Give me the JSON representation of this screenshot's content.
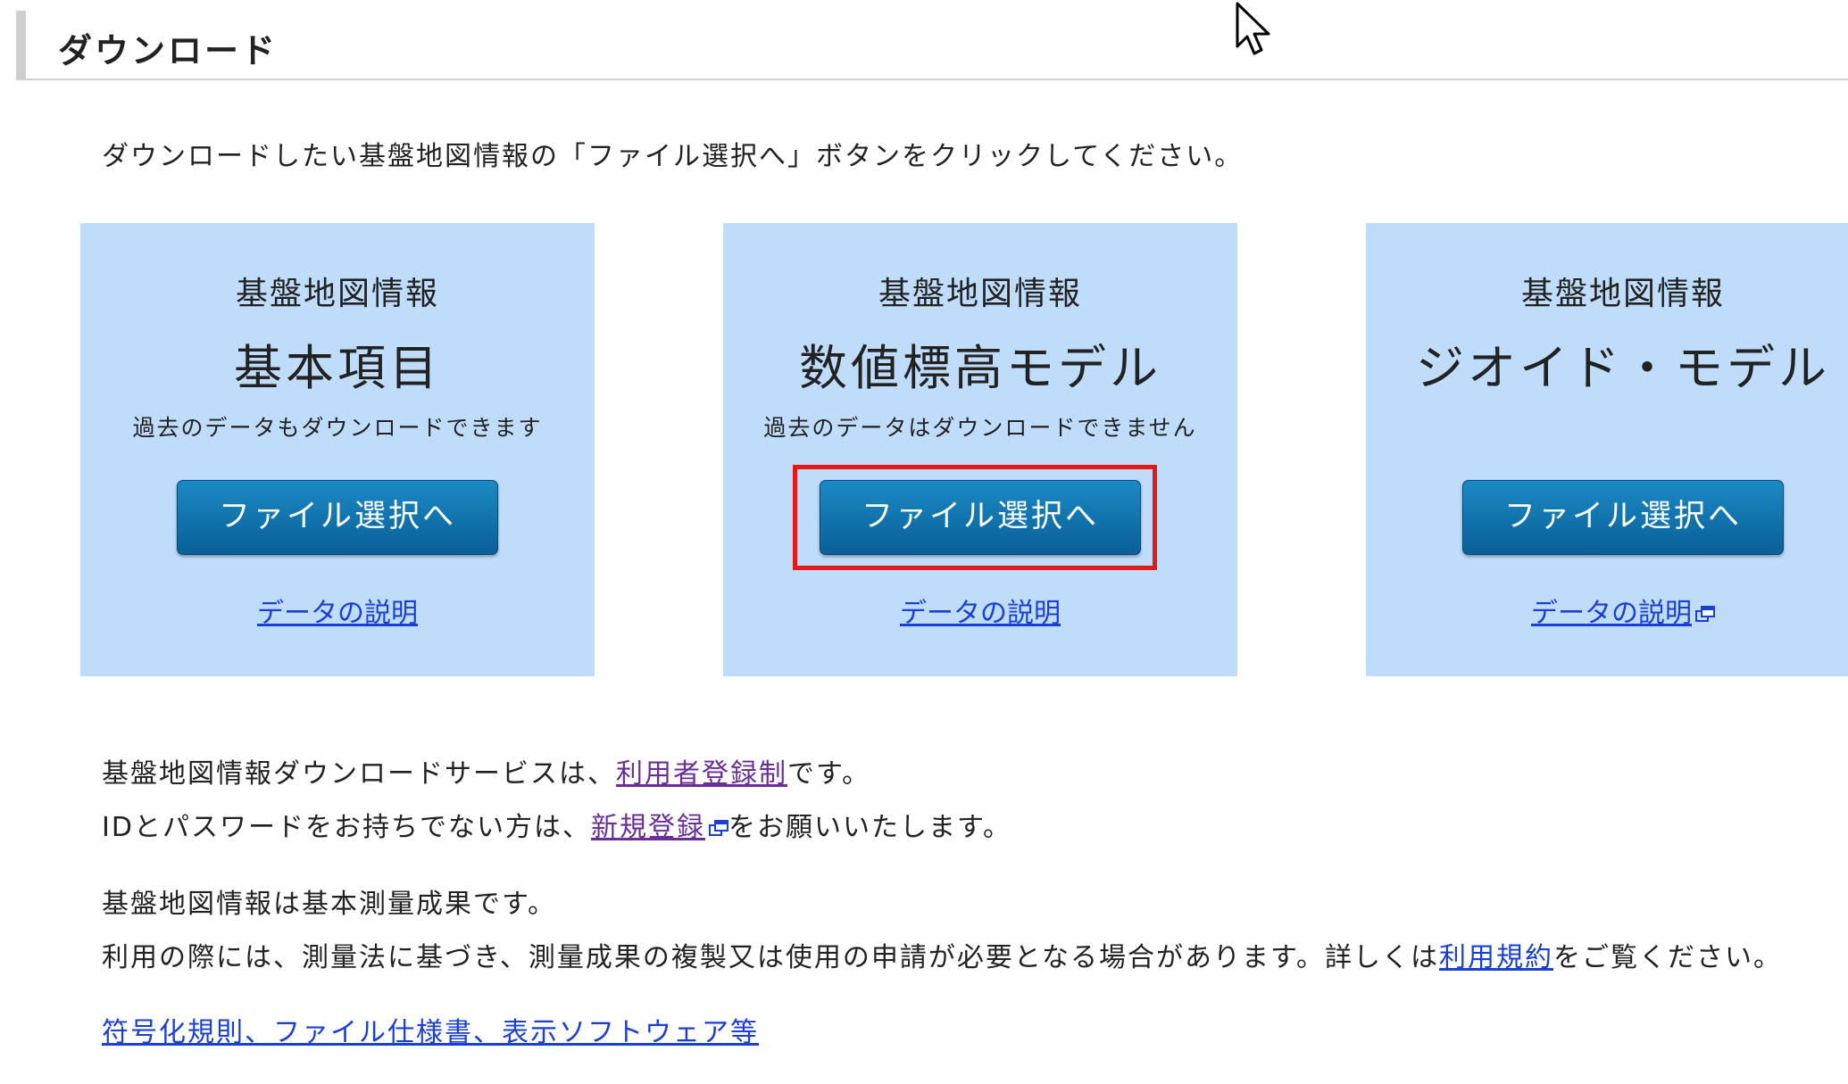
{
  "section": {
    "title": "ダウンロード"
  },
  "intro": "ダウンロードしたい基盤地図情報の「ファイル選択へ」ボタンをクリックしてください。",
  "cards": [
    {
      "subtitle": "基盤地図情報",
      "title": "基本項目",
      "note": "過去のデータもダウンロードできます",
      "button_label": "ファイル選択へ",
      "link_label": "データの説明"
    },
    {
      "subtitle": "基盤地図情報",
      "title": "数値標高モデル",
      "note": "過去のデータはダウンロードできません",
      "button_label": "ファイル選択へ",
      "link_label": "データの説明"
    },
    {
      "subtitle": "基盤地図情報",
      "title": "ジオイド・モデル",
      "note": "",
      "button_label": "ファイル選択へ",
      "link_label": "データの説明"
    }
  ],
  "registration": {
    "line1_before": "基盤地図情報ダウンロードサービスは、",
    "line1_link": "利用者登録制",
    "line1_after": "です。",
    "line2_before": "IDとパスワードをお持ちでない方は、",
    "line2_link": "新規登録",
    "line2_after": "をお願いいたします。"
  },
  "terms": {
    "line1": "基盤地図情報は基本測量成果です。",
    "line2_before": "利用の際には、測量法に基づき、測量成果の複製又は使用の申請が必要となる場合があります。詳しくは",
    "line2_link": "利用規約",
    "line2_after": "をご覧ください。"
  },
  "docs_link": "符号化規則、ファイル仕様書、表示ソフトウェア等",
  "colors": {
    "card_bg": "#bfdcfa",
    "button_top": "#1b8ac6",
    "button_bottom": "#0a5f96",
    "link": "#1a3fd6",
    "visited_link": "#6a2d99",
    "highlight": "#e01919"
  }
}
